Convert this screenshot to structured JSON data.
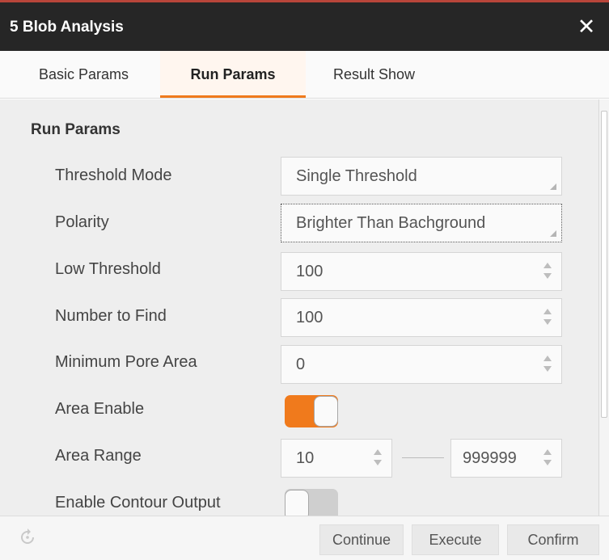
{
  "window": {
    "title": "5 Blob Analysis",
    "close_glyph": "✕"
  },
  "tabs": [
    {
      "label": "Basic Params"
    },
    {
      "label": "Run Params",
      "active": true
    },
    {
      "label": "Result Show"
    }
  ],
  "section": {
    "title": "Run Params"
  },
  "params": {
    "threshold_mode": {
      "label": "Threshold Mode",
      "value": "Single Threshold"
    },
    "polarity": {
      "label": "Polarity",
      "value": "Brighter Than Bachground"
    },
    "low_threshold": {
      "label": "Low Threshold",
      "value": "100"
    },
    "number_to_find": {
      "label": "Number to Find",
      "value": "100"
    },
    "min_pore_area": {
      "label": "Minimum Pore Area",
      "value": "0"
    },
    "area_enable": {
      "label": "Area Enable",
      "on": true
    },
    "area_range": {
      "label": "Area Range",
      "min": "10",
      "max": "999999"
    },
    "contour_output": {
      "label": "Enable Contour Output",
      "on": false
    }
  },
  "footer": {
    "continue_label": "Continue",
    "execute_label": "Execute",
    "confirm_label": "Confirm"
  },
  "colors": {
    "accent": "#f07a1c",
    "titlebar": "#262626",
    "titlebar_top": "#b8453a"
  },
  "icons": {
    "close": "close-icon",
    "reset": "reset-icon",
    "dropdown": "dropdown-corner-icon",
    "spinner": "spinner-icon"
  }
}
